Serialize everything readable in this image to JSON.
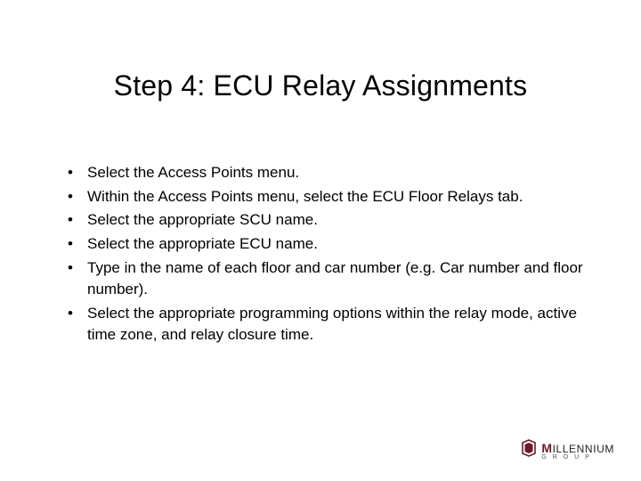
{
  "title": "Step 4: ECU Relay Assignments",
  "bullets": [
    "Select the Access Points menu.",
    "Within the Access Points menu, select the ECU Floor Relays tab.",
    "Select the appropriate SCU name.",
    "Select the appropriate ECU name.",
    "Type in the name of each floor and car number (e.g. Car number and floor number).",
    "Select the appropriate programming options within the relay mode, active time zone, and relay closure time."
  ],
  "logo": {
    "brand_rest": "ILLENNIUM",
    "sub": "G R O U P"
  }
}
